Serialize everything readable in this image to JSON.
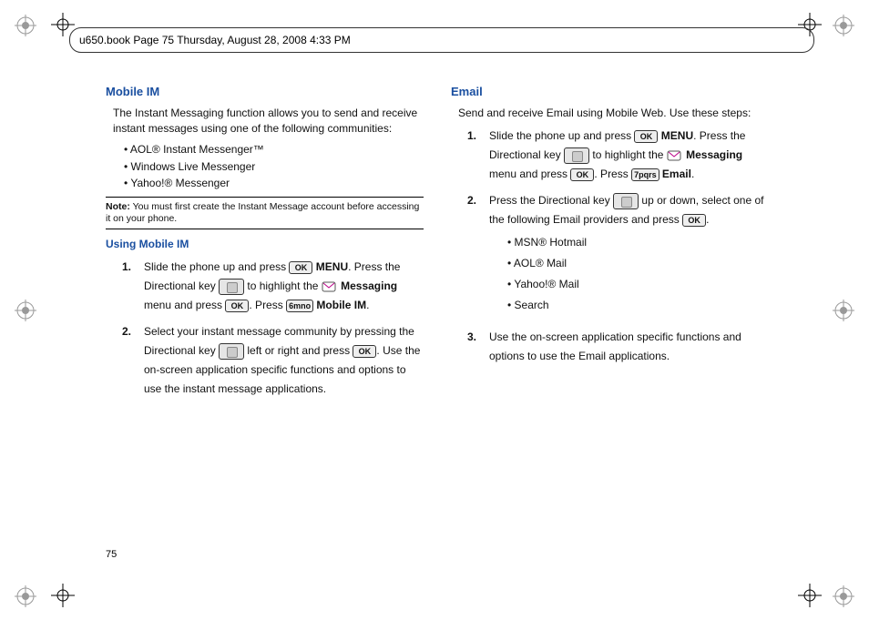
{
  "header": "u650.book  Page 75  Thursday, August 28, 2008  4:33 PM",
  "page_number": "75",
  "left_col": {
    "heading": "Mobile IM",
    "intro": "The Instant Messaging function allows you to send and receive instant messages using one of the following communities:",
    "providers": [
      "AOL® Instant Messenger™",
      "Windows Live Messenger",
      "Yahoo!® Messenger"
    ],
    "note_label": "Note:",
    "note": "You must first create the Instant Message account before accessing it on your phone.",
    "sub_heading": "Using Mobile IM",
    "step1_num": "1.",
    "step1_a": "Slide the phone up and press ",
    "step1_b": " MENU",
    "step1_c": ". Press the Directional key ",
    "step1_d": " to highlight the ",
    "step1_e": " Messaging",
    "step1_f": " menu and press ",
    "step1_g": ". Press ",
    "step1_h": " Mobile IM",
    "step1_i": ".",
    "step2_num": "2.",
    "step2_a": "Select your instant message community by pressing the Directional key ",
    "step2_b": " left or right and press ",
    "step2_c": ". Use the on-screen application specific functions and options to use the instant message applications.",
    "ok_label": "OK",
    "key6_label": "6mno"
  },
  "right_col": {
    "heading": "Email",
    "intro": "Send and receive Email using Mobile Web. Use these steps:",
    "step1_num": "1.",
    "step1_a": "Slide the phone up and press ",
    "step1_b": " MENU",
    "step1_c": ". Press the Directional key ",
    "step1_d": " to highlight the ",
    "step1_e": " Messaging",
    "step1_f": " menu and press ",
    "step1_g": ". Press ",
    "step1_h": " Email",
    "step1_i": ".",
    "key7_label": "7pqrs",
    "step2_num": "2.",
    "step2_a": "Press the Directional key ",
    "step2_b": " up or down, select one of the following Email providers and press ",
    "step2_c": ".",
    "providers": [
      "MSN® Hotmail",
      "AOL® Mail",
      "Yahoo!® Mail",
      "Search"
    ],
    "step3_num": "3.",
    "step3_a": "Use the on-screen application specific functions and options to use the Email applications.",
    "ok_label": "OK"
  }
}
